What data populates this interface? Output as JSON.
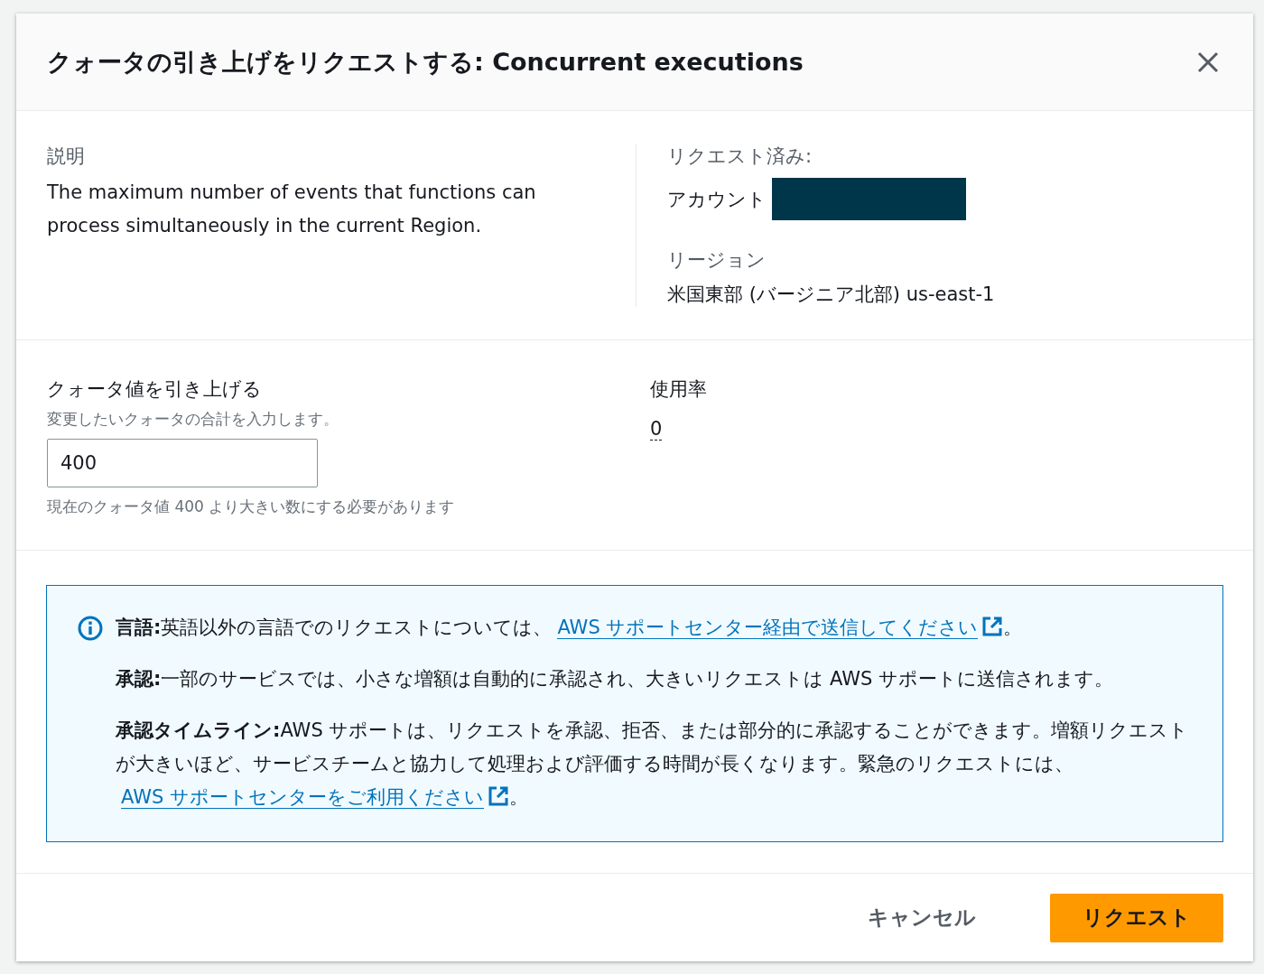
{
  "dialog": {
    "title": "クォータの引き上げをリクエストする: Concurrent executions"
  },
  "description": {
    "label": "説明",
    "text": "The maximum number of events that functions can process simultaneously in the current Region."
  },
  "requested_for": {
    "label": "リクエスト済み:",
    "account_label": "アカウント",
    "region_label": "リージョン",
    "region_value": "米国東部 (バージニア北部) us-east-1"
  },
  "increase": {
    "label": "クォータ値を引き上げる",
    "description": "変更したいクォータの合計を入力します。",
    "value": "400",
    "constraint": "現在のクォータ値 400 より大きい数にする必要があります"
  },
  "utilization": {
    "label": "使用率",
    "value": "0"
  },
  "info": [
    {
      "text": "**言語:**英語以外の言語でのリクエストについては、",
      "link": "AWS サポートセンター経由で送信してください",
      "after": "。"
    },
    {
      "text": "**承認:**一部のサービスでは、小さな増額は自動的に承認され、大きいリクエストは AWS サポートに送信されます。"
    },
    {
      "text": "**承認タイムライン:**AWS サポートは、リクエストを承認、拒否、または部分的に承認することができます。増額リクエストが大きいほど、サービスチームと協力して処理および評価する時間が長くなります。緊急のリクエストには、",
      "link": "AWS サポートセンターをご利用ください",
      "after": "。"
    }
  ],
  "buttons": [
    {
      "label": "キャンセル",
      "kind": "secondary"
    },
    {
      "label": "リクエスト",
      "kind": "primary"
    }
  ]
}
